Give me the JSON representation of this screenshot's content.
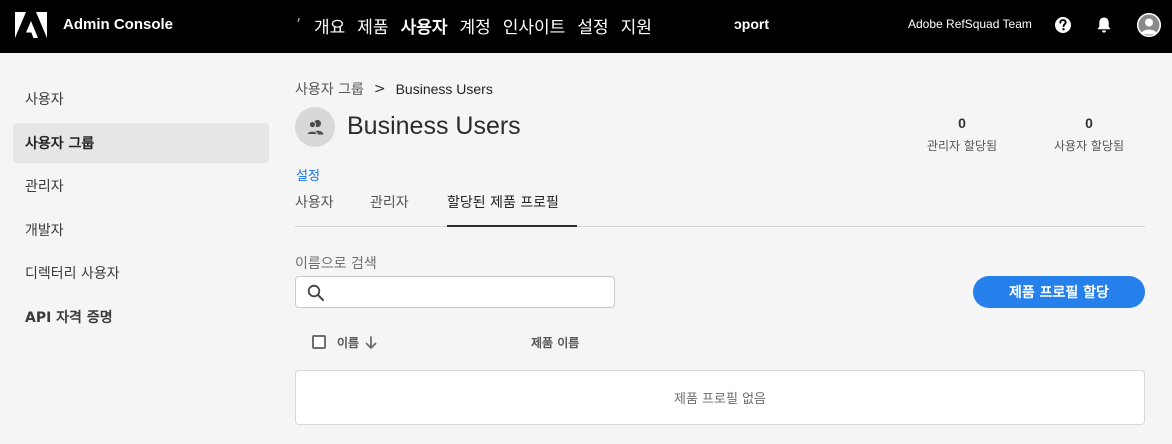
{
  "header": {
    "app_title": "Admin Console",
    "nav_partial": "ʼ",
    "nav": [
      "개요",
      "제품",
      "사용자",
      "계정",
      "인사이트",
      "설정",
      "지원"
    ],
    "nav_active": "사용자",
    "nav_clipped": "ɔport",
    "org_name": "Adobe RefSquad Team",
    "icons": [
      "help-icon",
      "bell-icon",
      "user-avatar-icon"
    ]
  },
  "sidebar": {
    "items": [
      {
        "label": "사용자"
      },
      {
        "label": "사용자 그룹"
      },
      {
        "label": "관리자"
      },
      {
        "label": "개발자"
      },
      {
        "label": "디렉터리 사용자"
      },
      {
        "label": "API 자격 증명"
      }
    ],
    "active": "사용자 그룹"
  },
  "breadcrumb": {
    "parent": "사용자 그룹",
    "separator": ">",
    "current": "Business Users"
  },
  "group": {
    "title": "Business Users",
    "stats": [
      {
        "value": "0",
        "label": "관리자 할당됨"
      },
      {
        "value": "0",
        "label": "사용자 할당됨"
      }
    ]
  },
  "settings_link": "설정",
  "tabs": [
    {
      "label": "사용자"
    },
    {
      "label": "관리자"
    },
    {
      "label": "할당된 제품 프로필"
    }
  ],
  "active_tab": "할당된 제품 프로필",
  "search": {
    "label": "이름으로 검색",
    "value": ""
  },
  "assign_button": "제품 프로필 할당",
  "table": {
    "columns": [
      "이름",
      "제품 이름"
    ],
    "sort": "descending",
    "empty_message": "제품 프로필 없음"
  },
  "colors": {
    "topbar": "#000000",
    "accent": "#2680eb",
    "link": "#1473e6",
    "background": "#f5f5f5"
  }
}
